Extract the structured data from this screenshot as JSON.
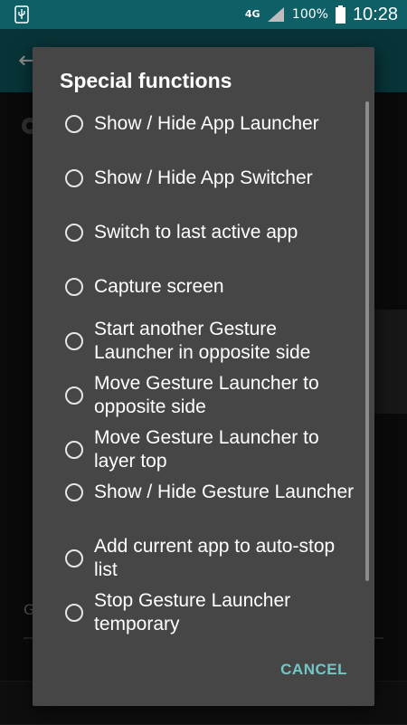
{
  "status_bar": {
    "usb_icon": "usb-icon",
    "network": "4G",
    "signal_icon": "signal-icon",
    "battery_pct": "100%",
    "battery_icon": "battery-icon",
    "time": "10:28"
  },
  "dialog": {
    "title": "Special functions",
    "options": [
      {
        "label": "Show / Hide App Launcher"
      },
      {
        "label": "Show / Hide App Switcher"
      },
      {
        "label": "Switch to last active app"
      },
      {
        "label": "Capture screen"
      },
      {
        "label": "Start another Gesture Launcher in opposite side"
      },
      {
        "label": "Move Gesture Launcher to opposite side"
      },
      {
        "label": "Move Gesture Launcher to layer top"
      },
      {
        "label": "Show / Hide Gesture Launcher"
      },
      {
        "label": "Add current app to auto-stop list"
      },
      {
        "label": "Stop Gesture Launcher temporary"
      }
    ],
    "cancel_label": "CANCEL"
  },
  "background": {
    "fragment_text": "G"
  },
  "colors": {
    "dialog_bg": "#464646",
    "accent": "#71c7c7",
    "toolbar": "#0f5f66"
  }
}
